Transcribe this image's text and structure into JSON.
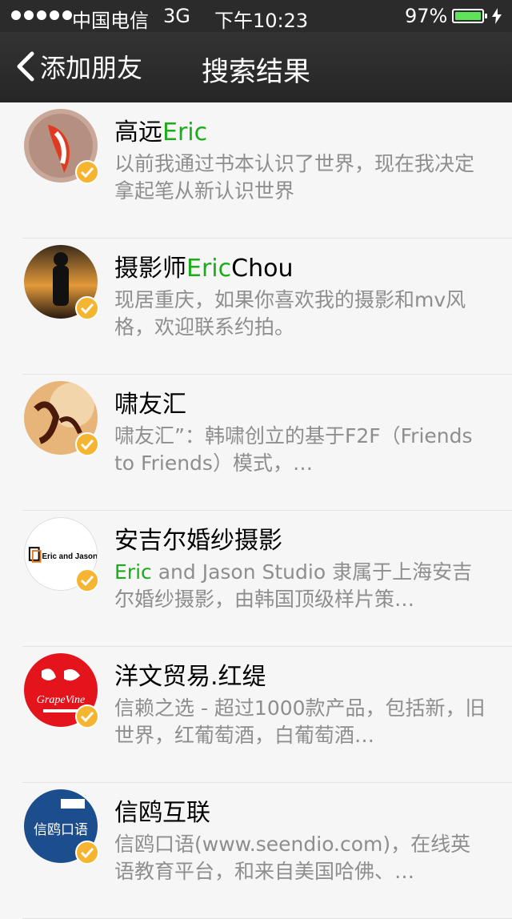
{
  "status_bar": {
    "carrier": "中国电信",
    "network": "3G",
    "time": "下午10:23",
    "battery": "97%",
    "battery_level": 0.97
  },
  "nav": {
    "back_label": "添加朋友",
    "title": "搜索结果"
  },
  "colors": {
    "highlight": "#1aad19",
    "badge": "#f6b531"
  },
  "results": [
    {
      "name_pre": "高远",
      "name_hl": "Eric",
      "name_post": "",
      "desc_hl": "",
      "desc": "以前我通过书本认识了世界，现在我决定拿起笔从新认识世界",
      "avatar": "koi-fish"
    },
    {
      "name_pre": "摄影师",
      "name_hl": "Eric",
      "name_post": "Chou",
      "desc_hl": "",
      "desc": "现居重庆，如果你喜欢我的摄影和mv风格，欢迎联系约拍。",
      "avatar": "sunset-silhouette"
    },
    {
      "name_pre": "啸友汇",
      "name_hl": "",
      "name_post": "",
      "desc_hl": "",
      "desc": "啸友汇”：韩啸创立的基于F2F（Friends to Friends）模式，…",
      "avatar": "calligraphy"
    },
    {
      "name_pre": "安吉尔婚纱摄影",
      "name_hl": "",
      "name_post": "",
      "desc_hl": "Eric",
      "desc": " and Jason Studio 隶属于上海安吉尔婚纱摄影，由韩国顶级样片策…",
      "avatar": "eric-and-jason-logo",
      "avatar_text": "Eric and Jason"
    },
    {
      "name_pre": "洋文贸易.红缇",
      "name_hl": "",
      "name_post": "",
      "desc_hl": "",
      "desc": "信赖之选 - 超过1000款产品，包括新，旧世界，红葡萄酒，白葡萄酒…",
      "avatar": "grapevine-logo",
      "avatar_text": "GrapeVine"
    },
    {
      "name_pre": "信鸥互联",
      "name_hl": "",
      "name_post": "",
      "desc_hl": "",
      "desc": "信鸥口语(www.seendio.com)，在线英语教育平台，和来自美国哈佛、…",
      "avatar": "seendio-logo",
      "avatar_text": "信鸥口语"
    }
  ]
}
